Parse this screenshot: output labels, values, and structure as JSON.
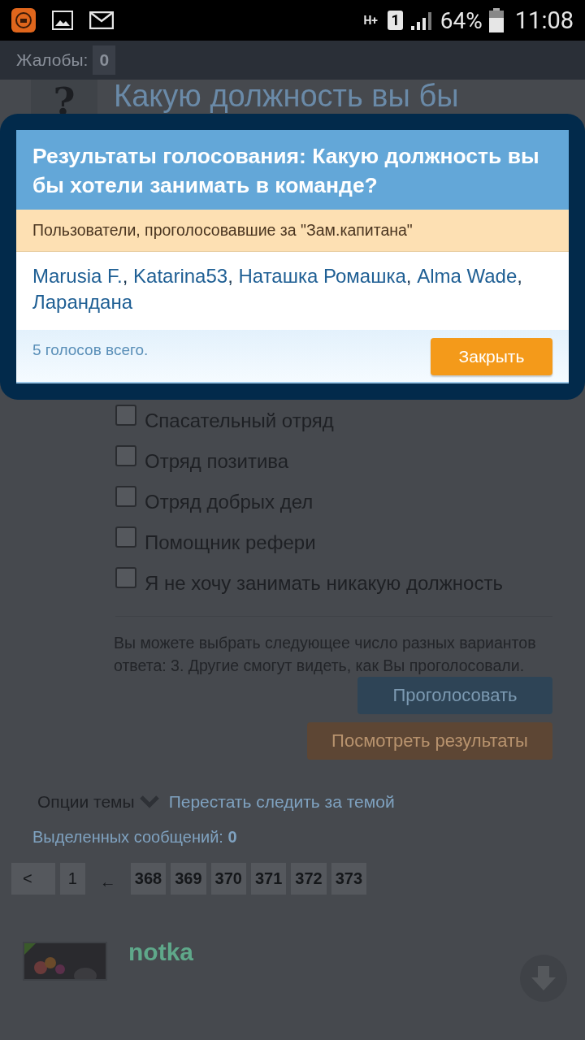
{
  "status_bar": {
    "network": "H+",
    "sim": "1",
    "battery": "64%",
    "time": "11:08"
  },
  "header": {
    "label": "Жалобы:",
    "count": "0"
  },
  "poll": {
    "icon": "?",
    "title": "Какую должность вы бы",
    "options": [
      {
        "label": "Спасательный отряд",
        "checked": false
      },
      {
        "label": "Отряд позитива",
        "checked": false
      },
      {
        "label": "Отряд добрых дел",
        "checked": false
      },
      {
        "label": "Помощник рефери",
        "checked": false
      },
      {
        "label": "Я не хочу занимать никакую должность",
        "checked": false
      }
    ],
    "note": "Вы можете выбрать следующее число разных вариантов ответа: 3. Другие смогут видеть, как Вы проголосовали.",
    "vote_button": "Проголосовать",
    "results_button": "Посмотреть результаты"
  },
  "thread": {
    "options_label": "Опции темы",
    "unwatch_link": "Перестать следить за темой",
    "selected_label": "Выделенных сообщений:",
    "selected_count": "0"
  },
  "pagination": {
    "prev": "<",
    "pages": [
      {
        "label": "1",
        "kind": "page"
      },
      {
        "label": "←",
        "kind": "separator"
      },
      {
        "label": "368",
        "kind": "page"
      },
      {
        "label": "369",
        "kind": "page"
      },
      {
        "label": "370",
        "kind": "page"
      },
      {
        "label": "371",
        "kind": "page"
      },
      {
        "label": "372",
        "kind": "page"
      },
      {
        "label": "373",
        "kind": "page"
      }
    ]
  },
  "post": {
    "author": "notka"
  },
  "modal": {
    "title": "Результаты голосования: Какую должность вы бы хотели занимать в команде?",
    "subtitle": "Пользователи, проголосовавшие за \"Зам.капитана\"",
    "separator": ",",
    "voters": [
      "Marusia F.",
      "Katarina53",
      "Наташка Ромашка",
      "Alma Wade",
      "Ларандана"
    ],
    "total": "5 голосов всего.",
    "close_button": "Закрыть"
  }
}
